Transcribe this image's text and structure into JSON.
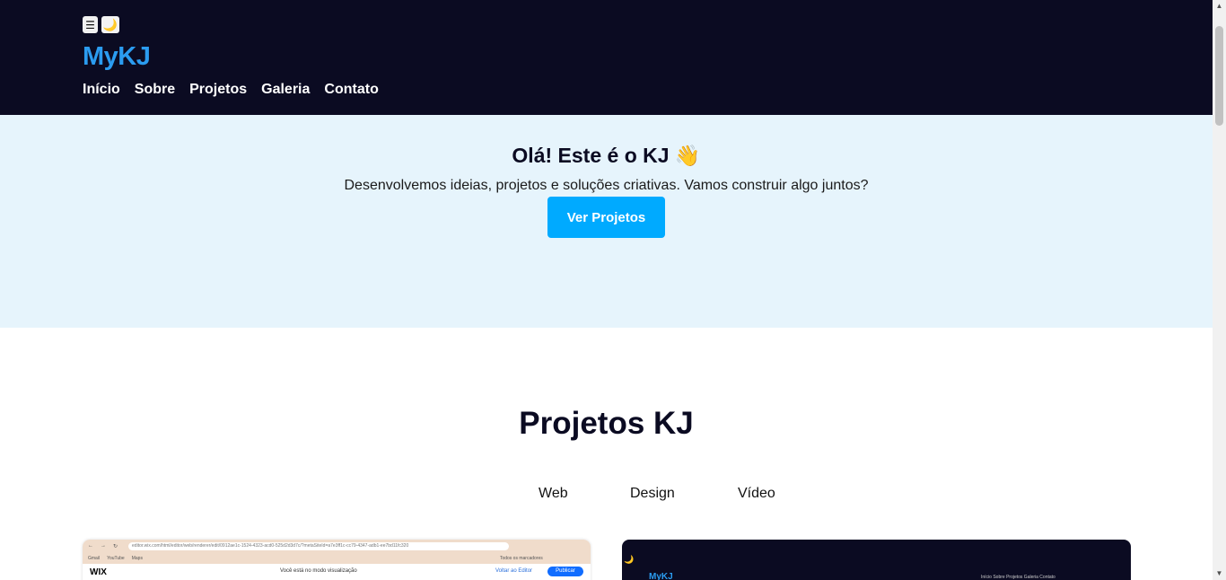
{
  "header": {
    "menu_icon": "☰",
    "theme_icon": "🌙",
    "logo": "MyKJ",
    "nav": [
      {
        "label": "Início"
      },
      {
        "label": "Sobre"
      },
      {
        "label": "Projetos"
      },
      {
        "label": "Galeria"
      },
      {
        "label": "Contato"
      }
    ]
  },
  "hero": {
    "title": "Olá! Este é o KJ 👋",
    "subtitle": "Desenvolvemos ideias, projetos e soluções criativas. Vamos construir algo juntos?",
    "cta_label": "Ver Projetos"
  },
  "projects": {
    "title": "Projetos KJ",
    "filters": [
      {
        "label": "Web"
      },
      {
        "label": "Design"
      },
      {
        "label": "Vídeo"
      }
    ],
    "card1": {
      "url": "editor.wix.com/html/editor/web/renderer/edit/0912ae1c-1524-4323-acd0-525d2d3d7c/?metaSiteId=a7e3ff1c-cc79-4347-adb1-ee7bd11fc320",
      "bookmarks": [
        "Gmail",
        "YouTube",
        "Maps"
      ],
      "bookmarks_right": "Todos os marcadores",
      "wix": "WIX",
      "preview_notice": "Você está no modo visualização",
      "back_to_editor": "Voltar ao Editor",
      "publish": "Publicar"
    },
    "card2": {
      "moon": "🌙",
      "logo": "MyKJ",
      "nav": "Início  Sobre  Projetos  Galeria  Contato"
    }
  },
  "scrollbar": {
    "up": "▲",
    "down": "▼"
  }
}
